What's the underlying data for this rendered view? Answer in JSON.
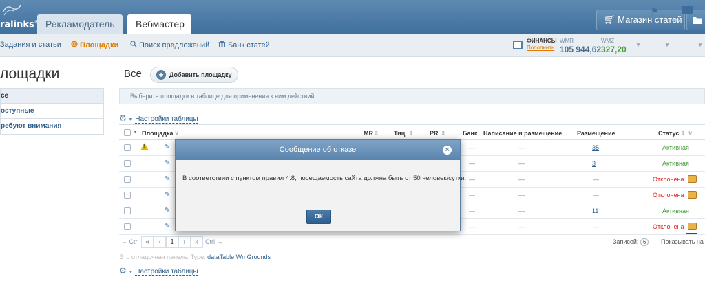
{
  "header": {
    "logo_text": "ralinks",
    "logo_sup": "®",
    "tabs": [
      {
        "label": "Рекламодатель"
      },
      {
        "label": "Вебмастер"
      }
    ],
    "store_button": "Магазин статей"
  },
  "subnav": {
    "items": [
      {
        "label": "Задания и статьи"
      },
      {
        "label": "Площадки"
      },
      {
        "label": "Поиск предложений"
      },
      {
        "label": "Банк статей"
      }
    ],
    "finance": {
      "title": "ФИНАНСЫ",
      "link": "Пополнить",
      "wmr_label": "WMR",
      "wmr_value": "105 944,62",
      "wmz_label": "WMZ",
      "wmz_value": "327,20"
    }
  },
  "sidebar": {
    "title": "лощадки",
    "items": [
      {
        "label": "се"
      },
      {
        "label": "оступные"
      },
      {
        "label": "ребуют внимания"
      }
    ]
  },
  "main": {
    "title": "Все",
    "add_button": "Добавить площадку",
    "hint": "↓ Выберите площадки в таблице для применения к ним действий",
    "settings_label": "Настройки таблицы",
    "debug_label": "Это отладочная панель. Type:",
    "debug_link": "dataTable.WmGrounds"
  },
  "table": {
    "columns": {
      "site": "Площадка",
      "mr": "MR",
      "tic": "Тиц",
      "pr": "PR",
      "bank": "Банк",
      "writing": "Написание и размещение",
      "placement": "Размещение",
      "status": "Статус"
    },
    "rows": [
      {
        "bank": "—",
        "writing": "—",
        "placement": "35",
        "status": "Активная",
        "state": "active",
        "warn": true
      },
      {
        "bank": "—",
        "writing": "—",
        "placement": "3",
        "status": "Активная",
        "state": "active",
        "warn": false
      },
      {
        "bank": "—",
        "writing": "—",
        "placement": "—",
        "status": "Отклонена",
        "state": "rejected",
        "warn": false
      },
      {
        "bank": "—",
        "writing": "—",
        "placement": "—",
        "status": "Отклонена",
        "state": "rejected",
        "warn": false
      },
      {
        "bank": "—",
        "writing": "—",
        "placement": "11",
        "status": "Активная",
        "state": "active",
        "warn": false
      },
      {
        "bank": "—",
        "writing": "—",
        "placement": "—",
        "status": "Отклонена",
        "state": "rejected",
        "warn": false
      }
    ],
    "pager": {
      "prev_hint": "← Ctrl",
      "first": "«",
      "prev": "‹",
      "page": "1",
      "next": "›",
      "last": "»",
      "next_hint": "Ctrl →",
      "records_label": "Записей:",
      "records_count": "6",
      "show_by": "Показывать на"
    }
  },
  "modal": {
    "title": "Сообщение об отказе",
    "close": "×",
    "message": "В соответствии с пунктом правил 4.8, посещаемость сайта должна быть от 50 человек/сутки.",
    "ok": "ОК"
  },
  "colors": {
    "topbar": "#4a78a3",
    "accent": "#e07b00",
    "active": "#3c9b2e",
    "rejected": "#e02020"
  }
}
